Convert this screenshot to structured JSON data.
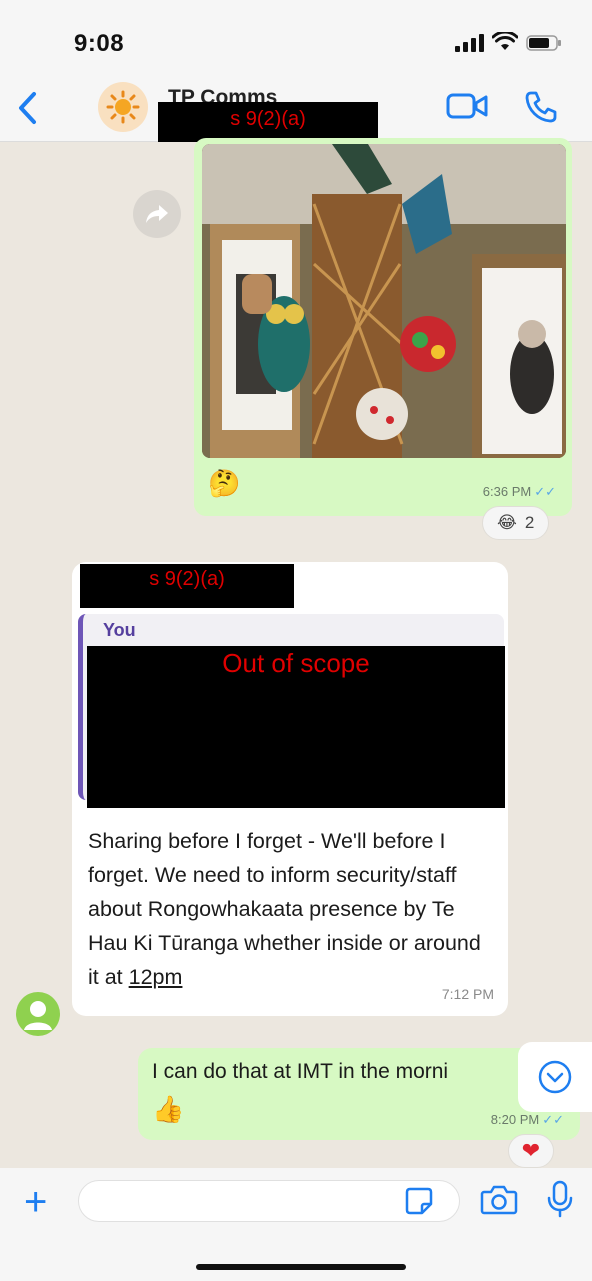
{
  "status_bar": {
    "time": "9:08"
  },
  "header": {
    "contact_name": "TP Comms",
    "redaction_label": "s 9(2)(a)"
  },
  "image_message": {
    "reaction_emoji_inline": "🤔",
    "time": "6:36 PM",
    "reaction_emoji": "😂",
    "reaction_count": "2"
  },
  "incoming_message": {
    "sender_redaction": "s 9(2)(a)",
    "quote_author": "You",
    "quote_redaction": "Out of scope",
    "text_before": "Sharing before I forget - We'll before I forget. We need to inform security/staff about Rongowhakaata presence by Te Hau Ki Tūranga whether inside or around it at ",
    "text_underlined": "12pm",
    "time": "7:12 PM"
  },
  "outgoing_message": {
    "text": "I can do that at IMT in the morni",
    "emoji": "👍",
    "time": "8:20 PM",
    "reaction": "❤"
  },
  "input_bar": {
    "placeholder": ""
  },
  "colors": {
    "accent": "#1e7ef0",
    "outgoing_bubble": "#d7f9c3",
    "chat_background": "#ece7df",
    "redaction_text": "#e00000"
  }
}
